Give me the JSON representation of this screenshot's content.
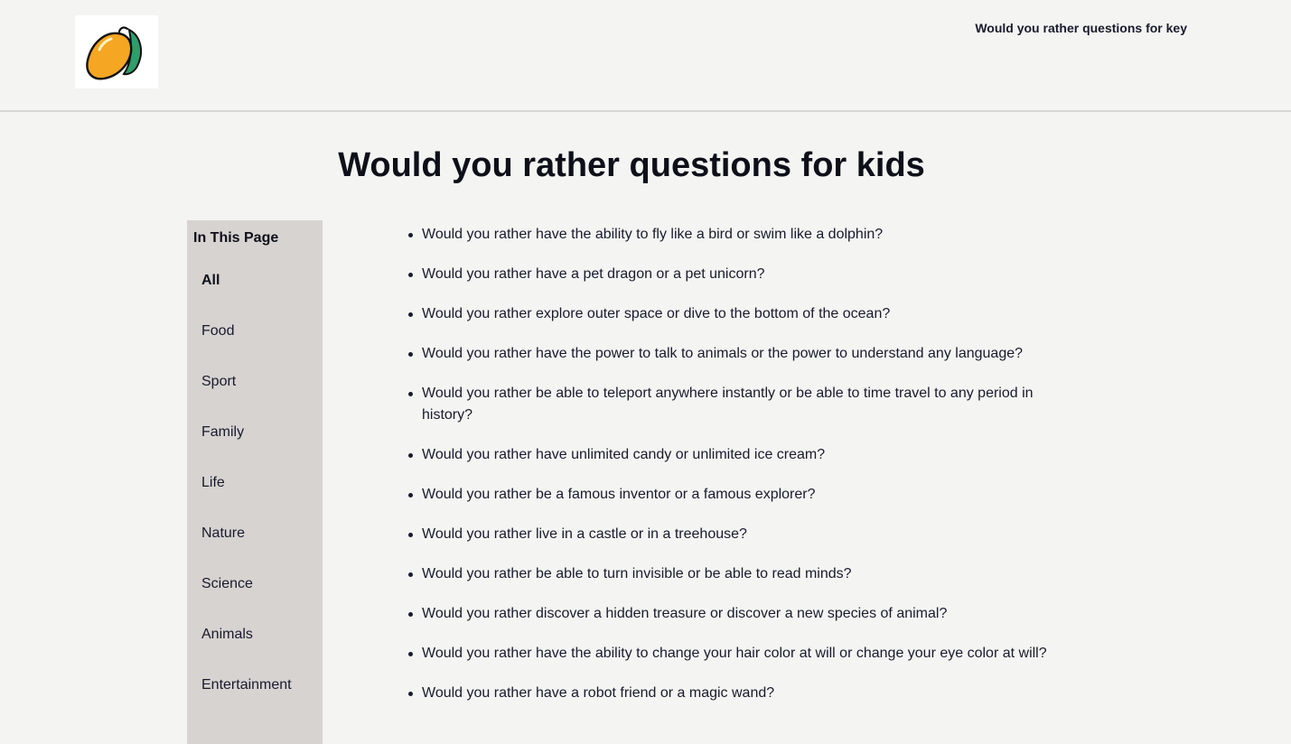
{
  "header": {
    "logo_icon": "mango-logo-icon",
    "nav_link": "Would you rather questions for key"
  },
  "page": {
    "title": "Would you rather questions for kids"
  },
  "toc": {
    "heading": "In This Page",
    "items": [
      {
        "label": "All",
        "active": true
      },
      {
        "label": "Food",
        "active": false
      },
      {
        "label": "Sport",
        "active": false
      },
      {
        "label": "Family",
        "active": false
      },
      {
        "label": "Life",
        "active": false
      },
      {
        "label": "Nature",
        "active": false
      },
      {
        "label": "Science",
        "active": false
      },
      {
        "label": "Animals",
        "active": false
      },
      {
        "label": "Entertainment",
        "active": false
      }
    ]
  },
  "questions": [
    "Would you rather have the ability to fly like a bird or swim like a dolphin?",
    "Would you rather have a pet dragon or a pet unicorn?",
    "Would you rather explore outer space or dive to the bottom of the ocean?",
    "Would you rather have the power to talk to animals or the power to understand any language?",
    "Would you rather be able to teleport anywhere instantly or be able to time travel to any period in history?",
    "Would you rather have unlimited candy or unlimited ice cream?",
    "Would you rather be a famous inventor or a famous explorer?",
    "Would you rather live in a castle or in a treehouse?",
    "Would you rather be able to turn invisible or be able to read minds?",
    "Would you rather discover a hidden treasure or discover a new species of animal?",
    "Would you rather have the ability to change your hair color at will or change your eye color at will?",
    "Would you rather have a robot friend or a magic wand?"
  ],
  "colors": {
    "background": "#f4f4f2",
    "sidebar": "#d6d3d0",
    "mango": "#f5a623",
    "leaf": "#2e9e6b"
  }
}
